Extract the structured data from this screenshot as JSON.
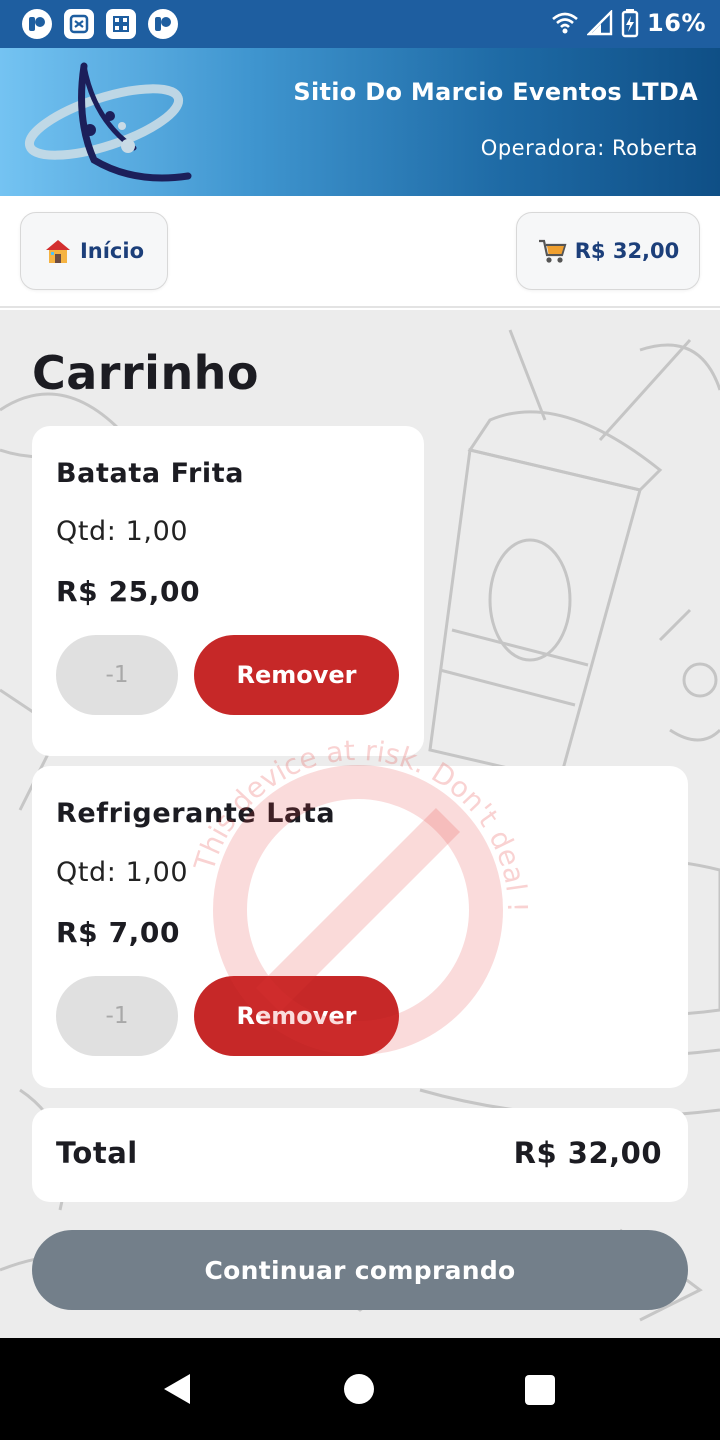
{
  "status_bar": {
    "battery": "16%",
    "icons": [
      "app-icon",
      "app-icon",
      "app-icon",
      "app-icon",
      "wifi-icon",
      "signal-icon",
      "battery-charging-icon"
    ]
  },
  "header": {
    "company": "Sitio Do Marcio Eventos LTDA",
    "operator": "Operadora: Roberta",
    "logo_icon": "orbit-logo-icon"
  },
  "nav": {
    "home_icon": "house-icon",
    "home_label": "Início",
    "cart_icon": "shopping-cart-icon",
    "cart_total": "R$ 32,00"
  },
  "page": {
    "title": "Carrinho"
  },
  "cart": {
    "items": [
      {
        "name": "Batata Frita",
        "qty": "Qtd: 1,00",
        "price": "R$ 25,00",
        "minus_label": "-1",
        "remove_label": "Remover"
      },
      {
        "name": "Refrigerante Lata",
        "qty": "Qtd: 1,00",
        "price": "R$ 7,00",
        "minus_label": "-1",
        "remove_label": "Remover"
      }
    ],
    "total_label": "Total",
    "total_value": "R$ 32,00",
    "continue_label": "Continuar comprando"
  },
  "watermark": {
    "text": "This device at risk. Don't deal !",
    "color": "#e53935"
  },
  "colors": {
    "header_start": "#74c3f2",
    "header_end": "#0f4f86",
    "remove": "#c62828",
    "continue": "#737f8a",
    "minus": "#e0e0e0"
  }
}
